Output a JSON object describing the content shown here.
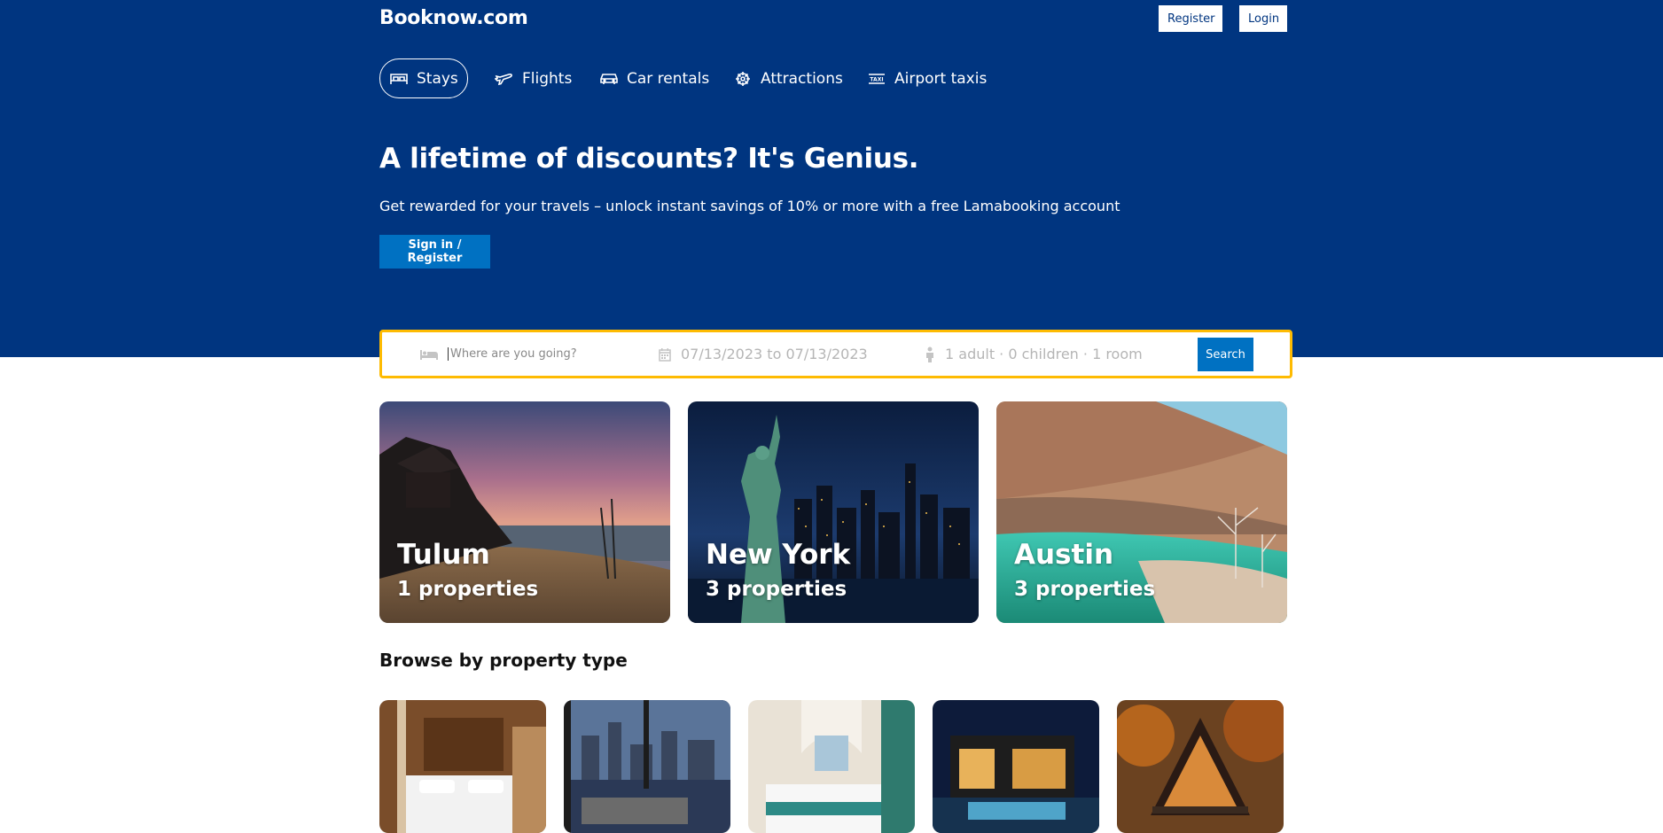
{
  "header": {
    "logo": "Booknow.com",
    "register_label": "Register",
    "login_label": "Login"
  },
  "nav": {
    "items": [
      {
        "label": "Stays",
        "icon": "bed-icon",
        "active": true
      },
      {
        "label": "Flights",
        "icon": "plane-icon",
        "active": false
      },
      {
        "label": "Car rentals",
        "icon": "car-icon",
        "active": false
      },
      {
        "label": "Attractions",
        "icon": "attraction-icon",
        "active": false
      },
      {
        "label": "Airport taxis",
        "icon": "taxi-icon",
        "active": false
      }
    ]
  },
  "hero": {
    "title": "A lifetime of discounts? It's Genius.",
    "subtitle": "Get rewarded for your travels – unlock instant savings of 10% or more with a free Lamabooking account",
    "button_label": "Sign in / Register"
  },
  "search": {
    "destination_placeholder": "Where are you going?",
    "dates": "07/13/2023 to 07/13/2023",
    "options": "1 adult · 0 children · 1 room",
    "button_label": "Search"
  },
  "featured": [
    {
      "city": "Tulum",
      "properties": "1 properties"
    },
    {
      "city": "New York",
      "properties": "3 properties"
    },
    {
      "city": "Austin",
      "properties": "3 properties"
    }
  ],
  "property_types": {
    "title": "Browse by property type"
  },
  "colors": {
    "header_bg": "#003580",
    "primary_button": "#0071c2",
    "search_border": "#febb02"
  }
}
